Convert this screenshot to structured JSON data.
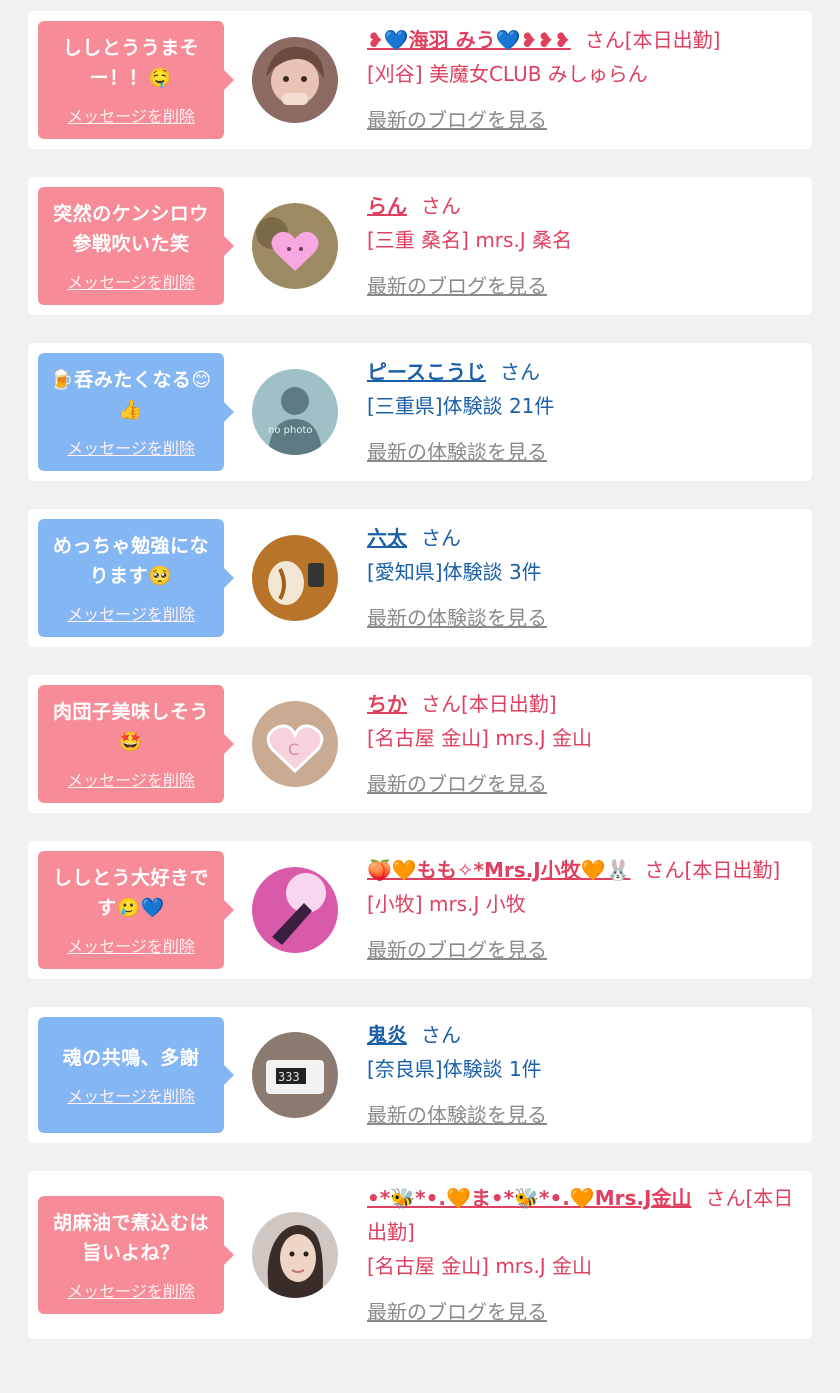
{
  "colors": {
    "pink_bubble": "#f78b98",
    "blue_bubble": "#85b6f4",
    "pink_text": "#e0405f",
    "blue_text": "#1a5fa8",
    "latest_link": "#8a8a8a",
    "background": "#f1f1f1"
  },
  "delete_label": "メッセージを削除",
  "entries": [
    {
      "message": "ししとううまそー！！🤤",
      "bubble": "pink",
      "avatar_icon": "woman-photo",
      "name": "❥💙海羽 みう💙❥❥❥",
      "honorific": "さん[本日出勤]",
      "detail": "[刈谷] 美魔女CLUB みしゅらん",
      "latest_link": "最新のブログを見る"
    },
    {
      "message": "突然のケンシロウ参戦吹いた笑",
      "bubble": "pink",
      "avatar_icon": "heart-face-photo",
      "name": "らん",
      "honorific": "さん",
      "detail": "[三重 桑名] mrs.J 桑名",
      "latest_link": "最新のブログを見る"
    },
    {
      "message": "🍺呑みたくなる😊👍",
      "bubble": "blue",
      "avatar_icon": "no-photo-silhouette",
      "name": "ピースこうじ",
      "honorific": "さん",
      "detail": "[三重県]体験談 21件",
      "latest_link": "最新の体験談を見る"
    },
    {
      "message": "めっちゃ勉強になります🥺",
      "bubble": "blue",
      "avatar_icon": "food-photo",
      "name": "六太",
      "honorific": "さん",
      "detail": "[愛知県]体験談 3件",
      "latest_link": "最新の体験談を見る"
    },
    {
      "message": "肉団子美味しそう🤩",
      "bubble": "pink",
      "avatar_icon": "heart-c-photo",
      "name": "ちか",
      "honorific": "さん[本日出勤]",
      "detail": "[名古屋 金山] mrs.J 金山",
      "latest_link": "最新のブログを見る"
    },
    {
      "message": "ししとう大好きです🥲💙",
      "bubble": "pink",
      "avatar_icon": "pink-light-photo",
      "name": "🍑🧡もも✧*Mrs.J小牧🧡🐰",
      "honorific": "さん[本日出勤]",
      "detail": "[小牧] mrs.J 小牧",
      "latest_link": "最新のブログを見る"
    },
    {
      "message": "魂の共鳴、多謝",
      "bubble": "blue",
      "avatar_icon": "clock-photo",
      "name": "鬼炎",
      "honorific": "さん",
      "detail": "[奈良県]体験談 1件",
      "latest_link": "最新の体験談を見る"
    },
    {
      "message": "胡麻油で煮込むは旨いよね？",
      "bubble": "pink",
      "avatar_icon": "woman-portrait-photo",
      "name": "•*🐝*•.🧡ま•*🐝*•.🧡Mrs.J金山",
      "honorific": "さん[本日出勤]",
      "detail": "[名古屋 金山] mrs.J 金山",
      "latest_link": "最新のブログを見る"
    }
  ]
}
